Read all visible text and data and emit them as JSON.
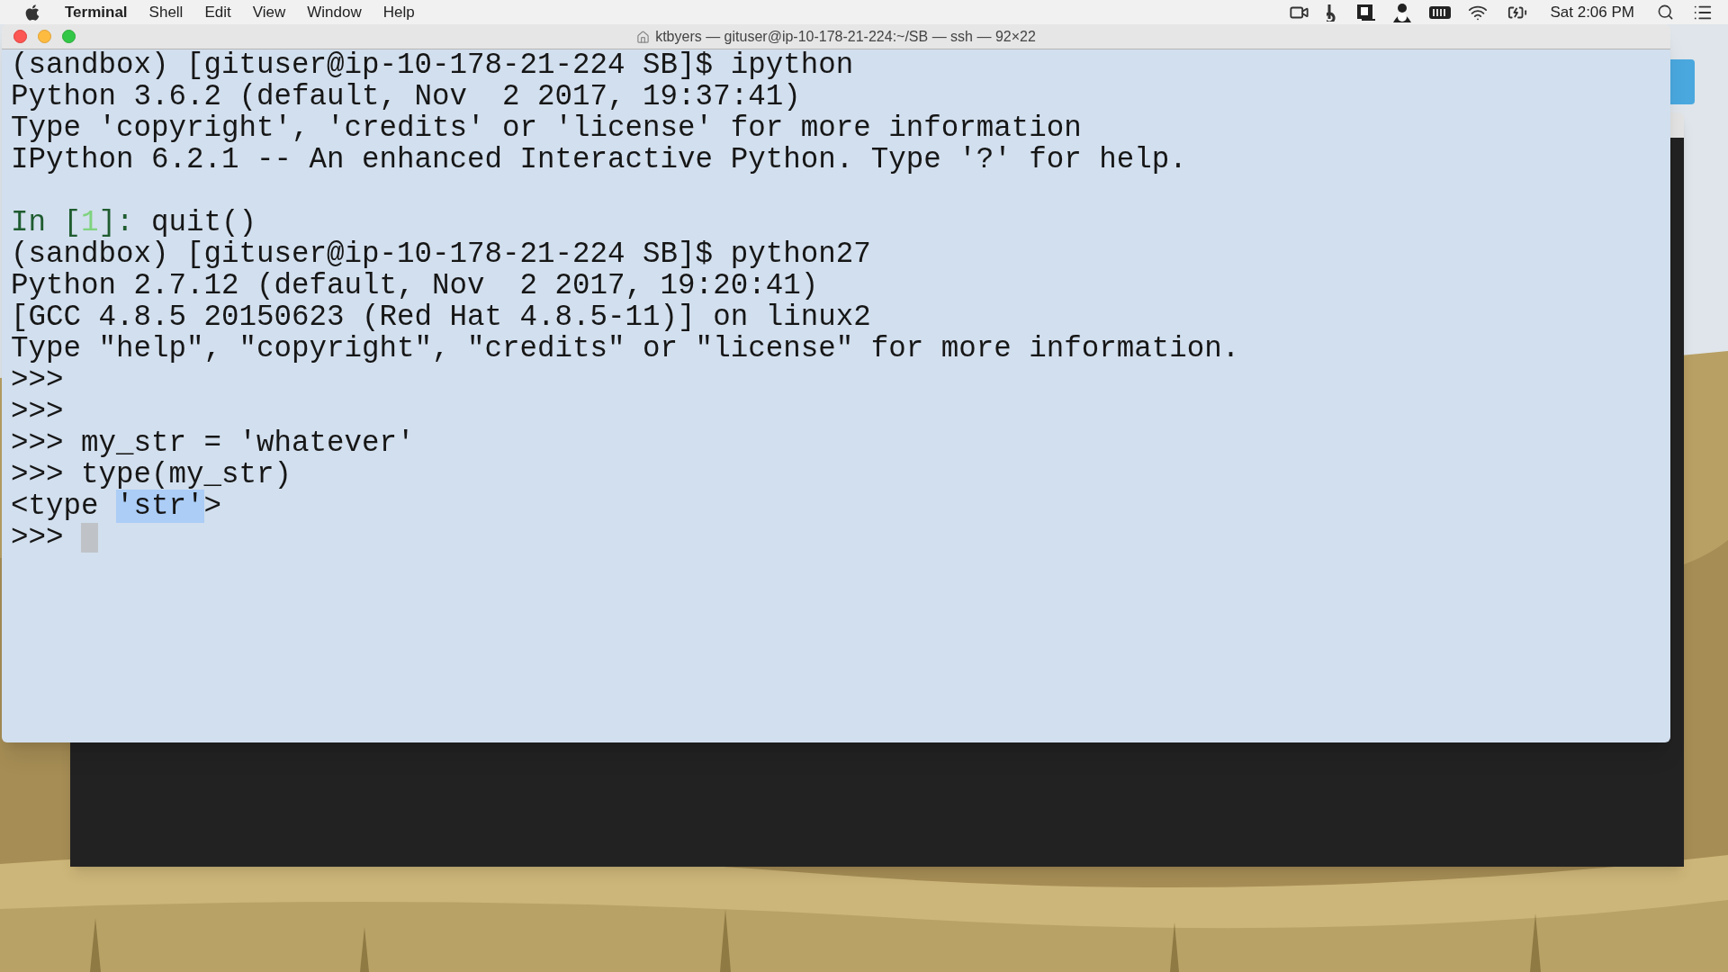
{
  "menu_bar": {
    "app": "Terminal",
    "menus": [
      "Shell",
      "Edit",
      "View",
      "Window",
      "Help"
    ],
    "clock": "Sat 2:06 PM"
  },
  "window": {
    "title": "ktbyers — gituser@ip-10-178-21-224:~/SB — ssh — 92×22",
    "lines": [
      {
        "kind": "plain",
        "text": "(sandbox) [gituser@ip-10-178-21-224 SB]$ ipython"
      },
      {
        "kind": "plain",
        "text": "Python 3.6.2 (default, Nov  2 2017, 19:37:41)"
      },
      {
        "kind": "plain",
        "text": "Type 'copyright', 'credits' or 'license' for more information"
      },
      {
        "kind": "plain",
        "text": "IPython 6.2.1 -- An enhanced Interactive Python. Type '?' for help."
      },
      {
        "kind": "blank"
      },
      {
        "kind": "segments",
        "segments": [
          {
            "text": "In [",
            "color": "#1f5c30"
          },
          {
            "text": "1",
            "color": "#7fd37f"
          },
          {
            "text": "]: ",
            "color": "#1f5c30"
          },
          {
            "text": "quit()"
          }
        ]
      },
      {
        "kind": "plain",
        "text": "(sandbox) [gituser@ip-10-178-21-224 SB]$ python27"
      },
      {
        "kind": "plain",
        "text": "Python 2.7.12 (default, Nov  2 2017, 19:20:41)"
      },
      {
        "kind": "plain",
        "text": "[GCC 4.8.5 20150623 (Red Hat 4.8.5-11)] on linux2"
      },
      {
        "kind": "plain",
        "text": "Type \"help\", \"copyright\", \"credits\" or \"license\" for more information."
      },
      {
        "kind": "plain",
        "text": ">>>"
      },
      {
        "kind": "plain",
        "text": ">>>"
      },
      {
        "kind": "plain",
        "text": ">>> my_str = 'whatever'"
      },
      {
        "kind": "plain",
        "text": ">>> type(my_str)"
      },
      {
        "kind": "segments",
        "segments": [
          {
            "text": "<type "
          },
          {
            "text": "'str'",
            "selected": true
          },
          {
            "text": ">"
          }
        ]
      },
      {
        "kind": "cursor",
        "text": ">>> "
      }
    ]
  }
}
